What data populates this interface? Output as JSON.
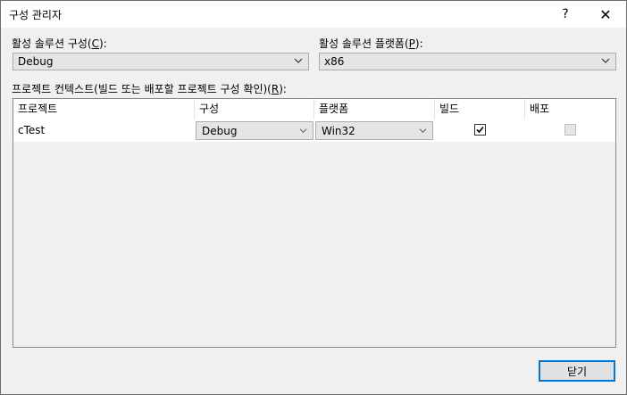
{
  "window": {
    "title": "구성 관리자",
    "help_label": "?",
    "close_label": "✕"
  },
  "solution_config": {
    "label_prefix": "활성 솔루션 구성(",
    "label_mnemonic": "C",
    "label_suffix": "):",
    "value": "Debug"
  },
  "solution_platform": {
    "label_prefix": "활성 솔루션 플랫폼(",
    "label_mnemonic": "P",
    "label_suffix": "):",
    "value": "x86"
  },
  "grid": {
    "caption_prefix": "프로젝트 컨텍스트(빌드 또는 배포할 프로젝트 구성 확인)(",
    "caption_mnemonic": "R",
    "caption_suffix": "):",
    "columns": [
      "프로젝트",
      "구성",
      "플랫폼",
      "빌드",
      "배포"
    ],
    "rows": [
      {
        "project": "cTest",
        "configuration": "Debug",
        "platform": "Win32",
        "build": true,
        "deploy": false
      }
    ]
  },
  "footer": {
    "close_label": "닫기"
  },
  "colors": {
    "accent": "#0078d7",
    "window_bg": "#f0f0f0",
    "combo_bg": "#e5e5e5"
  }
}
